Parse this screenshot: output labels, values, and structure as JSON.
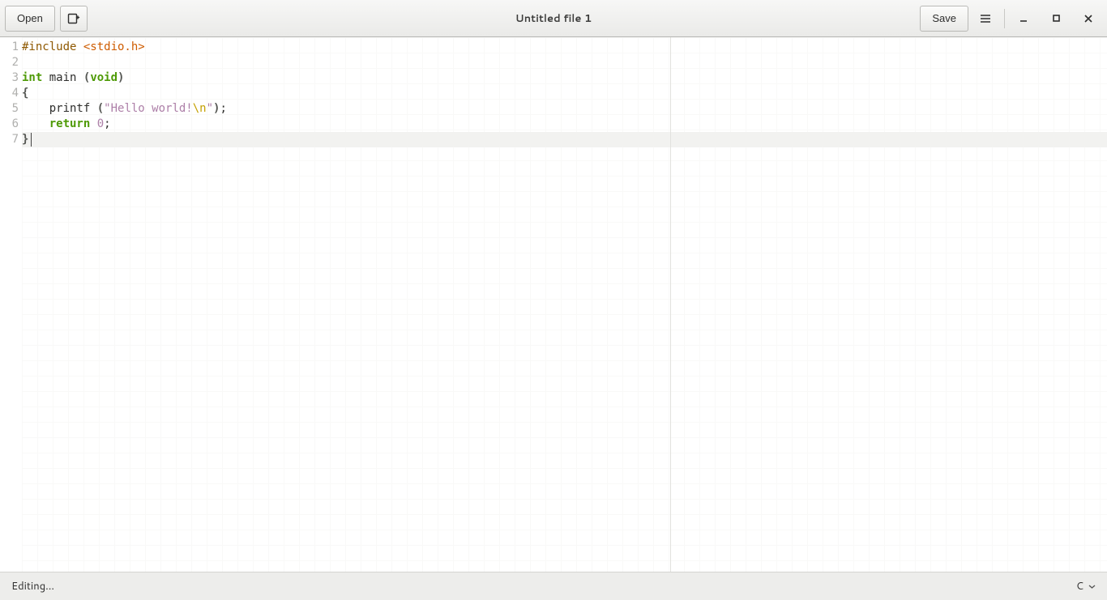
{
  "header": {
    "open_label": "Open",
    "save_label": "Save",
    "title": "Untitled file 1"
  },
  "editor": {
    "line_numbers": [
      "1",
      "2",
      "3",
      "4",
      "5",
      "6",
      "7"
    ],
    "current_line": 7,
    "margin_column": 80,
    "lines": [
      [
        {
          "t": "#include ",
          "c": "pp"
        },
        {
          "t": "<stdio.h>",
          "c": "inc"
        }
      ],
      [],
      [
        {
          "t": "int",
          "c": "kw"
        },
        {
          "t": " main ",
          "c": "txt"
        },
        {
          "t": "(",
          "c": "pun"
        },
        {
          "t": "void",
          "c": "kw"
        },
        {
          "t": ")",
          "c": "pun"
        }
      ],
      [
        {
          "t": "{",
          "c": "pun"
        }
      ],
      [
        {
          "t": "    printf ",
          "c": "txt"
        },
        {
          "t": "(",
          "c": "pun"
        },
        {
          "t": "\"Hello world!",
          "c": "str"
        },
        {
          "t": "\\n",
          "c": "esc"
        },
        {
          "t": "\"",
          "c": "str"
        },
        {
          "t": ")",
          "c": "pun"
        },
        {
          "t": ";",
          "c": "txt"
        }
      ],
      [
        {
          "t": "    ",
          "c": "txt"
        },
        {
          "t": "return",
          "c": "kw"
        },
        {
          "t": " ",
          "c": "txt"
        },
        {
          "t": "0",
          "c": "num"
        },
        {
          "t": ";",
          "c": "txt"
        }
      ],
      [
        {
          "t": "}",
          "c": "pun"
        }
      ]
    ]
  },
  "status": {
    "left": "Editing...",
    "lang": "C"
  }
}
